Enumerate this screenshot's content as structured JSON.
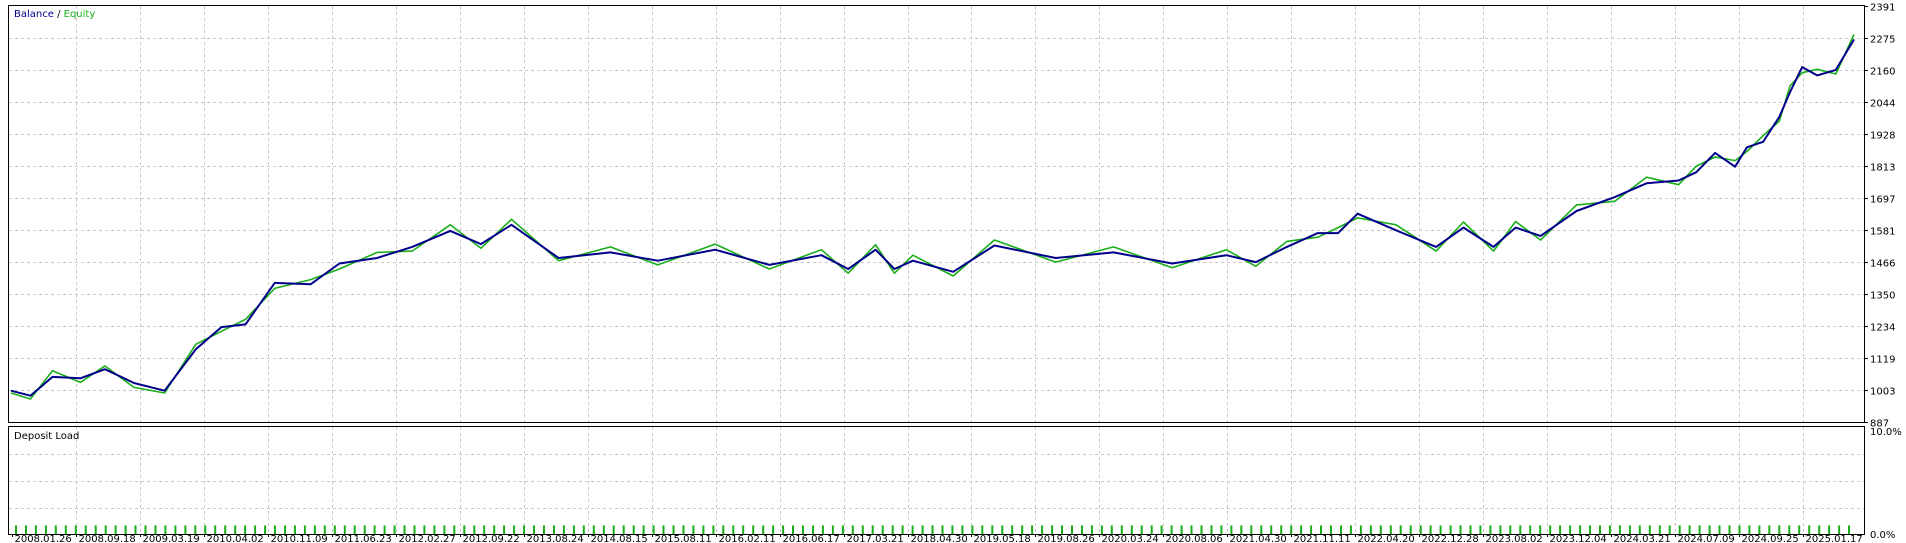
{
  "chart_data": [
    {
      "type": "line",
      "legend": {
        "balance_label": "Balance",
        "separator": " / ",
        "equity_label": "Equity",
        "placement": "top-left"
      },
      "colors": {
        "balance": "#00008b",
        "equity": "#1aae1a",
        "grid": "#c8c8c8",
        "frame": "#000000"
      },
      "grid": true,
      "ylim": [
        887,
        2391
      ],
      "y_ticks": [
        "2391",
        "2275",
        "2160",
        "2044",
        "1928",
        "1813",
        "1697",
        "1581",
        "1466",
        "1350",
        "1234",
        "1119",
        "1003",
        "887"
      ],
      "x_tick_labels": [
        "2008.01.26",
        "2008.09.18",
        "2009.03.19",
        "2010.04.02",
        "2010.11.09",
        "2011.06.23",
        "2012.02.27",
        "2012.09.22",
        "2013.08.24",
        "2014.08.15",
        "2015.08.11",
        "2016.02.11",
        "2016.06.17",
        "2017.03.21",
        "2018.04.30",
        "2019.05.18",
        "2019.08.26",
        "2020.03.24",
        "2020.08.06",
        "2021.04.30",
        "2021.11.11",
        "2022.04.20",
        "2022.12.28",
        "2023.08.02",
        "2023.12.04",
        "2024.03.21",
        "2024.07.09",
        "2024.09.25",
        "2025.01.17"
      ],
      "series": [
        {
          "name": "Balance",
          "x": [
            "2008.01.26",
            "2008.04.01",
            "2008.06.15",
            "2008.09.18",
            "2008.12.10",
            "2009.03.19",
            "2009.07.01",
            "2009.10.15",
            "2010.01.10",
            "2010.04.02",
            "2010.07.10",
            "2010.11.09",
            "2011.02.15",
            "2011.06.23",
            "2011.10.20",
            "2012.02.27",
            "2012.06.10",
            "2012.09.22",
            "2013.03.01",
            "2013.08.24",
            "2014.02.01",
            "2014.08.15",
            "2015.02.15",
            "2015.08.11",
            "2015.11.10",
            "2016.02.11",
            "2016.04.15",
            "2016.06.17",
            "2016.11.01",
            "2017.03.21",
            "2017.10.15",
            "2018.04.30",
            "2018.11.15",
            "2019.05.18",
            "2019.08.26",
            "2019.12.10",
            "2020.03.24",
            "2020.06.01",
            "2020.08.06",
            "2020.12.15",
            "2021.04.30",
            "2021.08.01",
            "2021.11.11",
            "2022.01.25",
            "2022.04.20",
            "2022.08.20",
            "2022.12.28",
            "2023.04.15",
            "2023.08.02",
            "2023.10.01",
            "2023.12.04",
            "2024.02.10",
            "2024.03.21",
            "2024.05.15",
            "2024.07.09",
            "2024.08.15",
            "2024.09.25",
            "2024.11.15",
            "2025.01.17",
            "2025.03.20"
          ],
          "values": [
            1000,
            982,
            1050,
            1045,
            1078,
            1028,
            1000,
            1150,
            1230,
            1240,
            1390,
            1385,
            1460,
            1480,
            1520,
            1578,
            1530,
            1600,
            1480,
            1500,
            1470,
            1510,
            1455,
            1490,
            1440,
            1510,
            1440,
            1470,
            1430,
            1525,
            1480,
            1500,
            1460,
            1490,
            1465,
            1520,
            1570,
            1570,
            1640,
            1580,
            1520,
            1590,
            1520,
            1590,
            1560,
            1650,
            1700,
            1750,
            1760,
            1790,
            1860,
            1810,
            1880,
            1900,
            1990,
            2080,
            2170,
            2140,
            2160,
            2270
          ]
        },
        {
          "name": "Equity",
          "x": [
            "2008.01.26",
            "2008.04.01",
            "2008.06.15",
            "2008.09.18",
            "2008.12.10",
            "2009.03.19",
            "2009.07.01",
            "2009.10.15",
            "2010.01.10",
            "2010.04.02",
            "2010.07.10",
            "2010.11.09",
            "2011.02.15",
            "2011.06.23",
            "2011.10.20",
            "2012.02.27",
            "2012.06.10",
            "2012.09.22",
            "2013.03.01",
            "2013.08.24",
            "2014.02.01",
            "2014.08.15",
            "2015.02.15",
            "2015.08.11",
            "2015.11.10",
            "2016.02.11",
            "2016.04.15",
            "2016.06.17",
            "2016.11.01",
            "2017.03.21",
            "2017.10.15",
            "2018.04.30",
            "2018.11.15",
            "2019.05.18",
            "2019.08.26",
            "2019.12.10",
            "2020.03.24",
            "2020.06.01",
            "2020.08.06",
            "2020.12.15",
            "2021.04.30",
            "2021.08.01",
            "2021.11.11",
            "2022.01.25",
            "2022.04.20",
            "2022.08.20",
            "2022.12.28",
            "2023.04.15",
            "2023.08.02",
            "2023.10.01",
            "2023.12.04",
            "2024.02.10",
            "2024.03.21",
            "2024.05.15",
            "2024.07.09",
            "2024.08.15",
            "2024.09.25",
            "2024.11.15",
            "2025.01.17",
            "2025.03.20"
          ],
          "values": [
            992,
            970,
            1072,
            1030,
            1090,
            1012,
            992,
            1168,
            1215,
            1258,
            1370,
            1402,
            1440,
            1500,
            1505,
            1600,
            1515,
            1620,
            1470,
            1520,
            1455,
            1530,
            1440,
            1510,
            1425,
            1528,
            1425,
            1490,
            1415,
            1545,
            1465,
            1520,
            1445,
            1510,
            1450,
            1540,
            1555,
            1590,
            1625,
            1600,
            1505,
            1610,
            1505,
            1612,
            1545,
            1672,
            1685,
            1772,
            1745,
            1812,
            1845,
            1832,
            1865,
            1922,
            1975,
            2102,
            2150,
            2162,
            2145,
            2288
          ]
        }
      ]
    },
    {
      "type": "bar",
      "title": "Deposit Load",
      "y_ticks": [
        "10.0%",
        "0.0%"
      ],
      "ylim": [
        0,
        10
      ],
      "colors": {
        "bar": "#1aae1a"
      },
      "bar_count": 185,
      "bar_value": 0.8
    }
  ]
}
